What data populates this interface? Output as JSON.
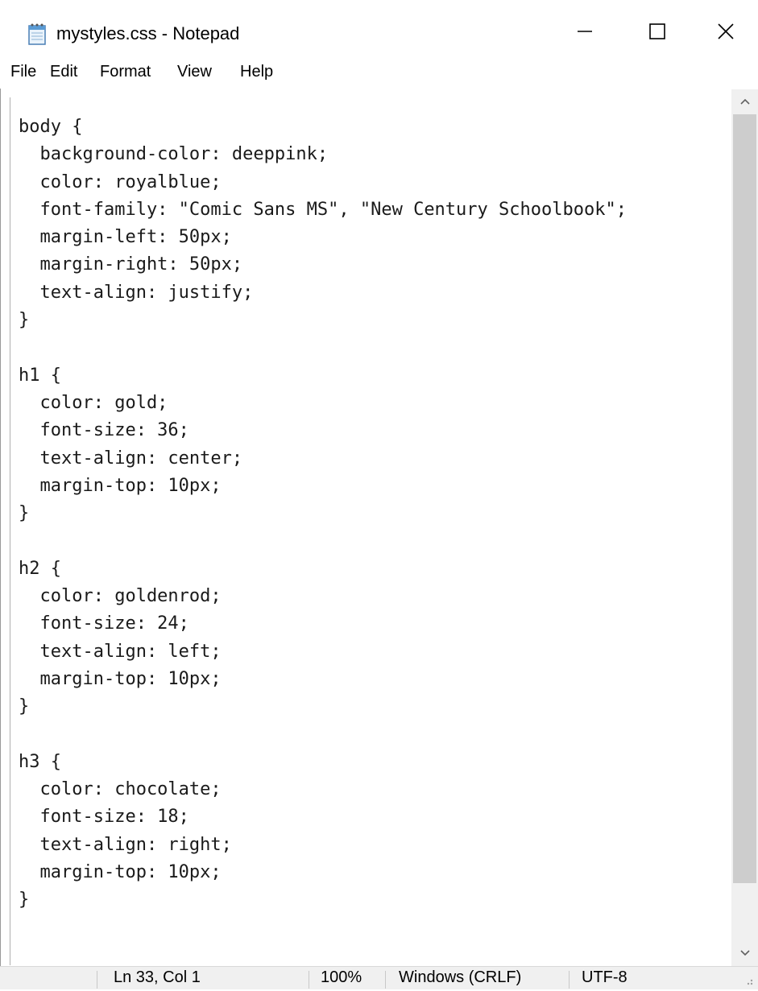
{
  "window": {
    "title": "mystyles.css - Notepad",
    "app_icon": "notepad-icon",
    "controls": {
      "minimize": "minimize-icon",
      "maximize": "maximize-icon",
      "close": "close-icon"
    }
  },
  "menu": [
    {
      "label": "File"
    },
    {
      "label": "Edit"
    },
    {
      "label": "Format"
    },
    {
      "label": "View"
    },
    {
      "label": "Help"
    }
  ],
  "editor": {
    "lines": [
      "body {",
      "  background-color: deeppink;",
      "  color: royalblue;",
      "  font-family: \"Comic Sans MS\", \"New Century Schoolbook\";",
      "  margin-left: 50px;",
      "  margin-right: 50px;",
      "  text-align: justify;",
      "}",
      "",
      "h1 {",
      "  color: gold;",
      "  font-size: 36;",
      "  text-align: center;",
      "  margin-top: 10px;",
      "}",
      "",
      "h2 {",
      "  color: goldenrod;",
      "  font-size: 24;",
      "  text-align: left;",
      "  margin-top: 10px;",
      "}",
      "",
      "h3 {",
      "  color: chocolate;",
      "  font-size: 18;",
      "  text-align: right;",
      "  margin-top: 10px;",
      "}"
    ]
  },
  "status": {
    "position": "Ln 33, Col 1",
    "zoom": "100%",
    "line_ending": "Windows (CRLF)",
    "encoding": "UTF-8"
  }
}
